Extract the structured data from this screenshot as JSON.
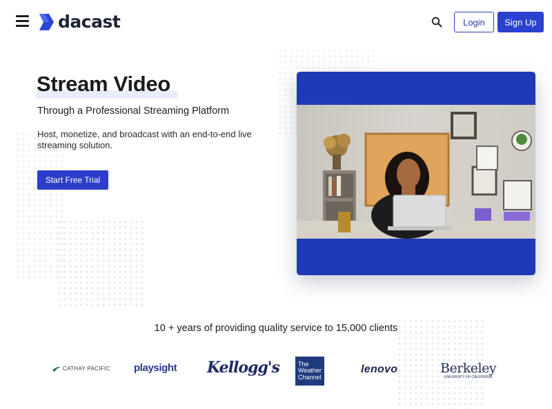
{
  "header": {
    "brand": "dacast",
    "login_label": "Login",
    "signup_label": "Sign Up",
    "menu_icon": "hamburger-menu-icon",
    "search_icon": "search-icon"
  },
  "hero": {
    "title": "Stream Video",
    "subtitle": "Through a Professional Streaming Platform",
    "description": "Host, monetize, and broadcast with an end-to-end live streaming solution.",
    "cta_label": "Start Free Trial"
  },
  "clients": {
    "heading": "10 + years of providing quality service to 15,000 clients",
    "logos": [
      {
        "name": "CATHAY PACIFIC"
      },
      {
        "name": "playsight"
      },
      {
        "name": "Kellogg's"
      },
      {
        "name": "The Weather Channel",
        "lines": [
          "The",
          "Weather",
          "Channel"
        ]
      },
      {
        "name": "lenovo"
      },
      {
        "name": "Berkeley",
        "tagline": "UNIVERSITY OF CALIFORNIA"
      }
    ]
  },
  "colors": {
    "accent": "#2b41d0",
    "video_card": "#1e3ab5",
    "text": "#1b1b1b"
  }
}
